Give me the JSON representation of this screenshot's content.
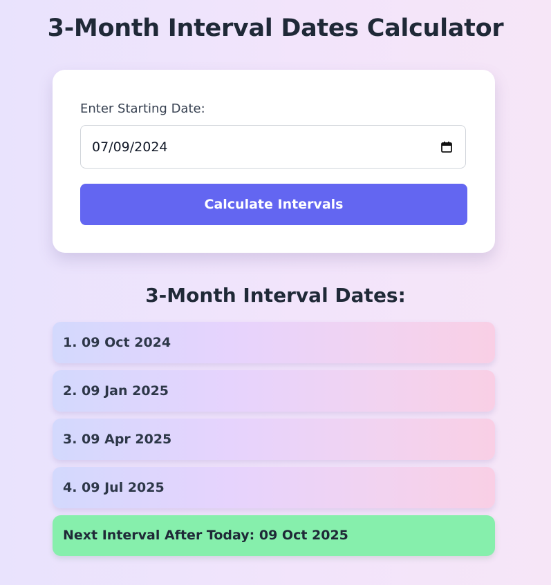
{
  "page": {
    "title": "3-Month Interval Dates Calculator"
  },
  "form": {
    "label": "Enter Starting Date:",
    "date_value": "07/09/2024",
    "button_label": "Calculate Intervals"
  },
  "results": {
    "heading": "3-Month Interval Dates:",
    "items": [
      "1. 09 Oct 2024",
      "2. 09 Jan 2025",
      "3. 09 Apr 2025",
      "4. 09 Jul 2025"
    ],
    "next_interval": "Next Interval After Today: 09 Oct 2025"
  },
  "colors": {
    "accent": "#6366f1",
    "next_highlight": "#86efac"
  },
  "icons": {
    "date_picker": "calendar-icon"
  }
}
